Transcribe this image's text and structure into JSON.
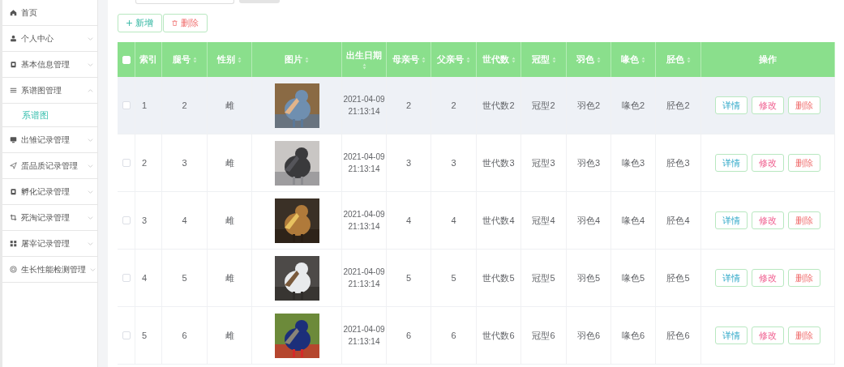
{
  "sidebar": {
    "items": [
      {
        "label": "首页"
      },
      {
        "label": "个人中心",
        "expanded": false
      },
      {
        "label": "基本信息管理",
        "expanded": false
      },
      {
        "label": "系谱图管理",
        "expanded": true,
        "children": [
          {
            "label": "系谱图",
            "selected": true
          }
        ]
      },
      {
        "label": "出雏记录管理",
        "expanded": false
      },
      {
        "label": "蛋品质记录管理",
        "expanded": false
      },
      {
        "label": "孵化记录管理",
        "expanded": false
      },
      {
        "label": "死淘记录管理",
        "expanded": false
      },
      {
        "label": "屠宰记录管理",
        "expanded": false
      },
      {
        "label": "生长性能检测管理",
        "expanded": false
      }
    ]
  },
  "toolbar": {
    "buttons": [
      {
        "kind": "add",
        "label": "新增"
      },
      {
        "kind": "delete",
        "label": "删除"
      }
    ]
  },
  "table": {
    "select_all": {
      "checked": false
    },
    "columns": [
      {
        "label": "索引",
        "sortable": false
      },
      {
        "label": "腿号",
        "sortable": true
      },
      {
        "label": "性别",
        "sortable": true
      },
      {
        "label": "图片",
        "sortable": true
      },
      {
        "label": "出生日期",
        "sortable": true
      },
      {
        "label": "母亲号",
        "sortable": true
      },
      {
        "label": "父亲号",
        "sortable": true
      },
      {
        "label": "世代数",
        "sortable": true
      },
      {
        "label": "冠型",
        "sortable": true
      },
      {
        "label": "羽色",
        "sortable": true
      },
      {
        "label": "喙色",
        "sortable": true
      },
      {
        "label": "胫色",
        "sortable": true
      },
      {
        "label": "操作",
        "sortable": false
      }
    ],
    "rows": [
      {
        "checked": false,
        "highlighted": true,
        "cells": [
          "1",
          "2",
          "雌",
          "",
          "2021-04-09 21:13:14",
          "2",
          "2",
          "世代数2",
          "冠型2",
          "羽色2",
          "喙色2",
          "胫色2"
        ],
        "actions": [
          {
            "kind": "detail",
            "label": "详情"
          },
          {
            "kind": "edit",
            "label": "修改"
          },
          {
            "kind": "delete",
            "label": "删除"
          }
        ]
      },
      {
        "checked": false,
        "highlighted": false,
        "cells": [
          "2",
          "3",
          "雌",
          "",
          "2021-04-09 21:13:14",
          "3",
          "3",
          "世代数3",
          "冠型3",
          "羽色3",
          "喙色3",
          "胫色3"
        ],
        "actions": [
          {
            "kind": "detail",
            "label": "详情"
          },
          {
            "kind": "edit",
            "label": "修改"
          },
          {
            "kind": "delete",
            "label": "删除"
          }
        ]
      },
      {
        "checked": false,
        "highlighted": false,
        "cells": [
          "3",
          "4",
          "雌",
          "",
          "2021-04-09 21:13:14",
          "4",
          "4",
          "世代数4",
          "冠型4",
          "羽色4",
          "喙色4",
          "胫色4"
        ],
        "actions": [
          {
            "kind": "detail",
            "label": "详情"
          },
          {
            "kind": "edit",
            "label": "修改"
          },
          {
            "kind": "delete",
            "label": "删除"
          }
        ]
      },
      {
        "checked": false,
        "highlighted": false,
        "cells": [
          "4",
          "5",
          "雌",
          "",
          "2021-04-09 21:13:14",
          "5",
          "5",
          "世代数5",
          "冠型5",
          "羽色5",
          "喙色5",
          "胫色5"
        ],
        "actions": [
          {
            "kind": "detail",
            "label": "详情"
          },
          {
            "kind": "edit",
            "label": "修改"
          },
          {
            "kind": "delete",
            "label": "删除"
          }
        ]
      },
      {
        "checked": false,
        "highlighted": false,
        "cells": [
          "5",
          "6",
          "雌",
          "",
          "2021-04-09 21:13:14",
          "6",
          "6",
          "世代数6",
          "冠型6",
          "羽色6",
          "喙色6",
          "胫色6"
        ],
        "actions": [
          {
            "kind": "detail",
            "label": "详情"
          },
          {
            "kind": "edit",
            "label": "修改"
          },
          {
            "kind": "delete",
            "label": "删除"
          }
        ]
      }
    ]
  }
}
